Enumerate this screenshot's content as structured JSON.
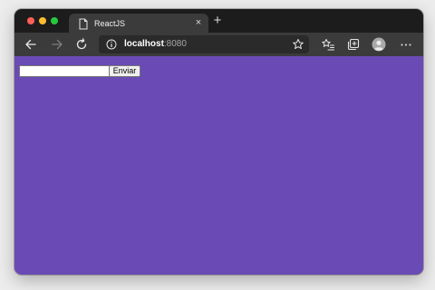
{
  "window": {
    "traffic_lights": {
      "close_color": "#ff5f57",
      "minimize_color": "#febc2e",
      "zoom_color": "#28c840"
    }
  },
  "tab": {
    "title": "ReactJS",
    "icon": "page-icon",
    "close_glyph": "×"
  },
  "new_tab_glyph": "+",
  "toolbar": {
    "back_icon": "back-arrow-icon",
    "forward_icon": "forward-arrow-icon",
    "reload_icon": "reload-icon",
    "info_icon": "info-icon",
    "favorite_icon": "star-icon",
    "favorites_icon": "favorites-list-icon",
    "collections_icon": "collections-icon",
    "profile_icon": "profile-avatar-icon",
    "menu_icon": "more-menu-icon"
  },
  "address": {
    "host": "localhost",
    "port": ":8080"
  },
  "page": {
    "background": "#6a4bb5",
    "input_value": "",
    "button_label": "Enviar"
  }
}
